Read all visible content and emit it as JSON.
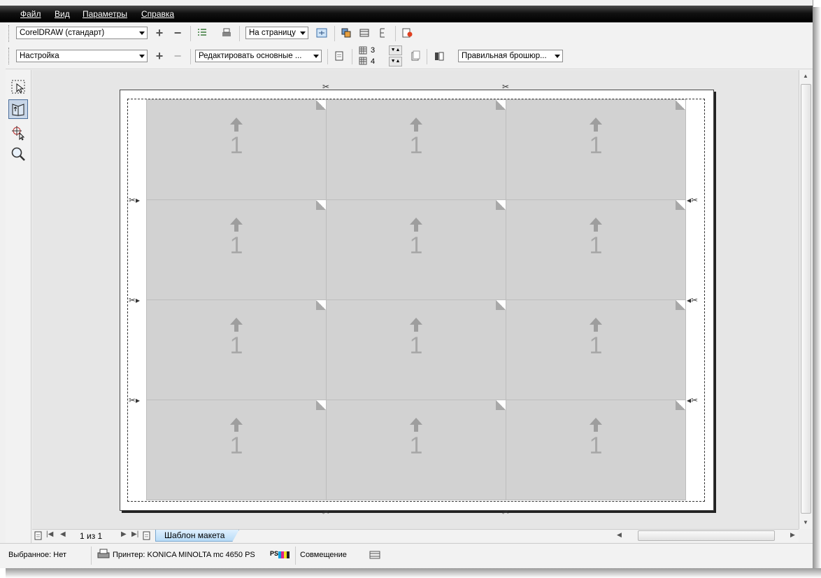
{
  "menu": [
    "Файл",
    "Вид",
    "Параметры",
    "Справка"
  ],
  "toolbar1": {
    "workspace": "CorelDRAW (стандарт)",
    "fit_mode": "На страницу"
  },
  "toolbar2": {
    "preset": "Настройка",
    "edit_basic": "Редактировать основные ...",
    "rows": "3",
    "cols": "4",
    "binding": "Правильная брошюр..."
  },
  "tools": [
    "pick-tool-icon",
    "imposition-tool-icon",
    "marks-tool-icon",
    "zoom-icon"
  ],
  "layout": {
    "rows": 4,
    "cols": 3,
    "cell_number": "1"
  },
  "navigator": {
    "page_of": "1 из 1",
    "tab_label": "Шаблон макета"
  },
  "status": {
    "selection": "Выбранное: Нет",
    "printer": "Принтер: KONICA MINOLTA mc 4650 PS",
    "ps_label": "PS",
    "align": "Совмещение"
  }
}
